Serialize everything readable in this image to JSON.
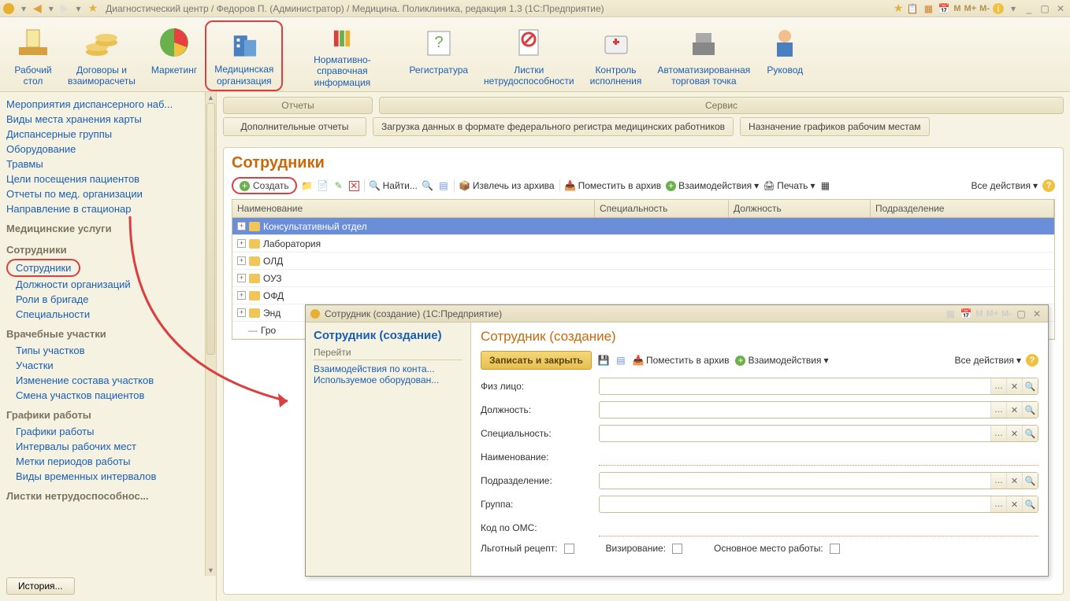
{
  "titlebar": {
    "title": "Диагностический центр / Федоров П. (Администратор) / Медицина. Поликлиника, редакция 1.3  (1С:Предприятие)",
    "m1": "M",
    "m2": "M+",
    "m3": "M-"
  },
  "sections": {
    "desktop": "Рабочий\nстол",
    "contracts": "Договоры и\nвзаиморасчеты",
    "marketing": "Маркетинг",
    "medorg": "Медицинская\nорганизация",
    "ref": "Нормативно-справочная\nинформация",
    "reg": "Регистратура",
    "sick": "Листки\nнетрудоспособности",
    "control": "Контроль\nисполнения",
    "pos": "Автоматизированная\nторговая точка",
    "mgr": "Руковод"
  },
  "svc": {
    "reports": "Отчеты",
    "service": "Сервис",
    "addreports": "Дополнительные отчеты",
    "load": "Загрузка данных в формате федерального регистра медицинских работников",
    "assign": "Назначение графиков рабочим местам"
  },
  "sidebar": {
    "l1": "Мероприятия диспансерного наб...",
    "l2": "Виды места хранения карты",
    "l3": "Диспансерные группы",
    "l4": "Оборудование",
    "l5": "Травмы",
    "l6": "Цели посещения пациентов",
    "l7": "Отчеты по мед. организации",
    "l8": "Направление в стационар",
    "h1": "Медицинские услуги",
    "h2": "Сотрудники",
    "l9": "Сотрудники",
    "l10": "Должности организаций",
    "l11": "Роли в бригаде",
    "l12": "Специальности",
    "h3": "Врачебные участки",
    "l13": "Типы участков",
    "l14": "Участки",
    "l15": "Изменение состава участков",
    "l16": "Смена участков пациентов",
    "h4": "Графики работы",
    "l17": "Графики работы",
    "l18": "Интервалы рабочих мест",
    "l19": "Метки периодов работы",
    "l20": "Виды временных интервалов",
    "h5": "Листки нетрудоспособнос..."
  },
  "panel": {
    "title": "Сотрудники",
    "create": "Создать",
    "find": "Найти...",
    "extract": "Извлечь из архива",
    "archive": "Поместить в архив",
    "inter": "Взаимодействия",
    "print": "Печать",
    "all": "Все действия"
  },
  "grid": {
    "c1": "Наименование",
    "c2": "Специальность",
    "c3": "Должность",
    "c4": "Подразделение",
    "r1": "Консультативный отдел",
    "r2": "Лаборатория",
    "r3": "ОЛД",
    "r4": "ОУЗ",
    "r5": "ОФД",
    "r6": "Энд",
    "r7": "Гро"
  },
  "history": "История...",
  "dialog": {
    "wintitle": "Сотрудник (создание)  (1С:Предприятие)",
    "sidetitle": "Сотрудник (создание)",
    "goto": "Перейти",
    "s1": "Взаимодействия по конта...",
    "s2": "Используемое оборудован...",
    "maintitle": "Сотрудник (создание)",
    "save": "Записать и закрыть",
    "archive": "Поместить в архив",
    "inter": "Взаимодействия",
    "all": "Все действия",
    "f_fiz": "Физ лицо:",
    "f_pos": "Должность:",
    "f_spec": "Специальность:",
    "f_name": "Наименование:",
    "f_dept": "Подразделение:",
    "f_group": "Группа:",
    "f_oms": "Код по ОМС:",
    "f_lg": "Льготный рецепт:",
    "f_viz": "Визирование:",
    "f_main": "Основное место работы:"
  }
}
